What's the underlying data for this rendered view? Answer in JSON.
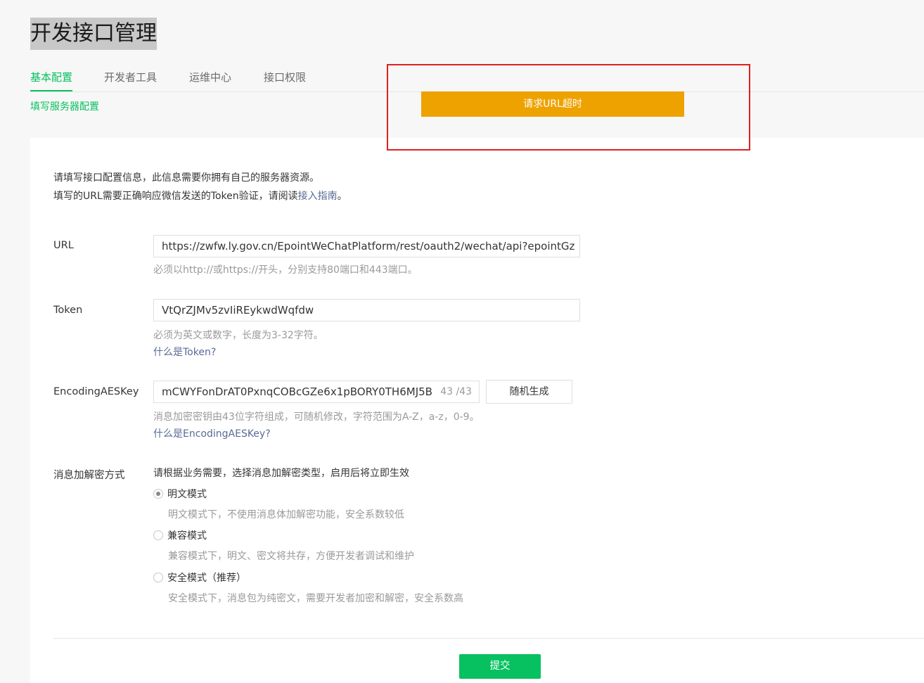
{
  "page": {
    "title": "开发接口管理"
  },
  "tabs": [
    {
      "label": "基本配置"
    },
    {
      "label": "开发者工具"
    },
    {
      "label": "运维中心"
    },
    {
      "label": "接口权限"
    }
  ],
  "sub_link": "填写服务器配置",
  "toast": "请求URL超时",
  "intro": {
    "line1": "请填写接口配置信息，此信息需要你拥有自己的服务器资源。",
    "line2_prefix": "填写的URL需要正确响应微信发送的Token验证，请阅读",
    "line2_link": "接入指南",
    "line2_suffix": "。"
  },
  "url": {
    "label": "URL",
    "value": "https://zwfw.ly.gov.cn/EpointWeChatPlatform/rest/oauth2/wechat/api?epointGz",
    "hint": "必须以http://或https://开头，分别支持80端口和443端口。"
  },
  "token": {
    "label": "Token",
    "value": "VtQrZJMv5zvIiREykwdWqfdw",
    "hint": "必须为英文或数字，长度为3-32字符。",
    "help_link": "什么是Token?"
  },
  "aeskey": {
    "label": "EncodingAESKey",
    "value": "mCWYFonDrAT0PxnqCOBcGZe6x1pBORY0TH6MJ5B",
    "counter": "43 /43",
    "generate_button": "随机生成",
    "hint": "消息加密密钥由43位字符组成，可随机修改，字符范围为A-Z，a-z，0-9。",
    "help_link": "什么是EncodingAESKey?"
  },
  "encryption": {
    "label": "消息加解密方式",
    "description": "请根据业务需要，选择消息加解密类型，启用后将立即生效",
    "options": [
      {
        "label": "明文模式",
        "desc": "明文模式下，不使用消息体加解密功能，安全系数较低",
        "checked": true
      },
      {
        "label": "兼容模式",
        "desc": "兼容模式下，明文、密文将共存，方便开发者调试和维护",
        "checked": false
      },
      {
        "label": "安全模式（推荐）",
        "desc": "安全模式下，消息包为纯密文，需要开发者加密和解密，安全系数高",
        "checked": false
      }
    ]
  },
  "submit_button": "提交",
  "colors": {
    "accent": "#07c160",
    "toast": "#eea200",
    "highlight": "#e02020",
    "link": "#576b95"
  }
}
